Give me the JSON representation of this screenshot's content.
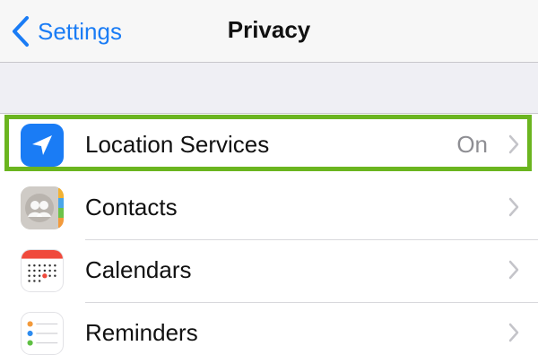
{
  "nav": {
    "back_label": "Settings",
    "title": "Privacy"
  },
  "rows": [
    {
      "label": "Location Services",
      "value": "On",
      "icon": "location-arrow-icon"
    },
    {
      "label": "Contacts",
      "value": "",
      "icon": "contacts-icon"
    },
    {
      "label": "Calendars",
      "value": "",
      "icon": "calendar-icon"
    },
    {
      "label": "Reminders",
      "value": "",
      "icon": "reminders-icon"
    }
  ],
  "colors": {
    "accent": "#1a7cf5",
    "highlight": "#6bb51f",
    "background": "#efeff4"
  }
}
